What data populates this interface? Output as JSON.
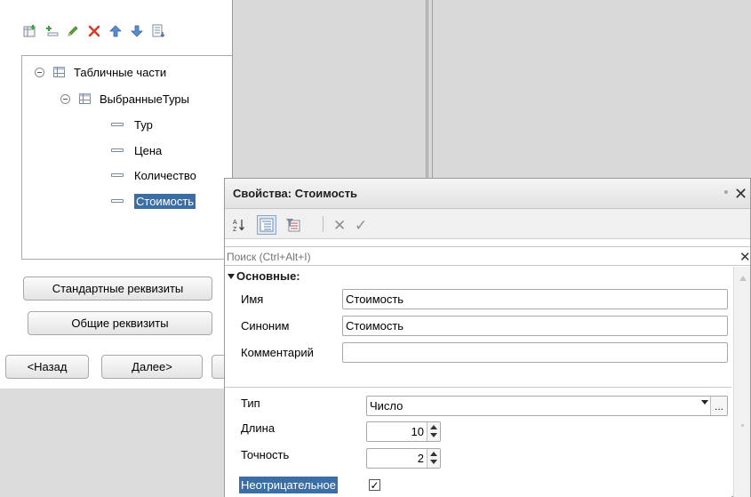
{
  "tree": {
    "items": [
      {
        "label": "Табличные части",
        "level": 0,
        "type": "table"
      },
      {
        "label": "ВыбранныеТуры",
        "level": 1,
        "type": "table"
      },
      {
        "label": "Тур",
        "level": 2,
        "type": "attribute"
      },
      {
        "label": "Цена",
        "level": 2,
        "type": "attribute"
      },
      {
        "label": "Количество",
        "level": 2,
        "type": "attribute"
      },
      {
        "label": "Стоимость",
        "level": 2,
        "type": "attribute",
        "selected": true
      }
    ]
  },
  "left_buttons": {
    "standard_attrs": "Стандартные реквизиты",
    "common_attrs": "Общие реквизиты",
    "back": "<Назад",
    "next": "Далее>"
  },
  "properties": {
    "title": "Свойства: Стоимость",
    "search_placeholder": "Поиск (Ctrl+Alt+I)",
    "group": "Основные:",
    "name_label": "Имя",
    "name_value": "Стоимость",
    "synonym_label": "Синоним",
    "synonym_value": "Стоимость",
    "comment_label": "Комментарий",
    "comment_value": "",
    "type_label": "Тип",
    "type_value": "Число",
    "length_label": "Длина",
    "length_value": "10",
    "precision_label": "Точность",
    "precision_value": "2",
    "nonnegative_label": "Неотрицательное",
    "nonnegative_checked": true
  },
  "colors": {
    "selection": "#3a6ea5",
    "add_green": "#3aa33a",
    "delete_red": "#d93a2b",
    "arrow_blue": "#4f7fc4"
  },
  "icons": [
    "add-table-icon",
    "add-attribute-icon",
    "edit-pencil-icon",
    "delete-icon",
    "move-up-icon",
    "move-down-icon",
    "sort-list-icon"
  ]
}
